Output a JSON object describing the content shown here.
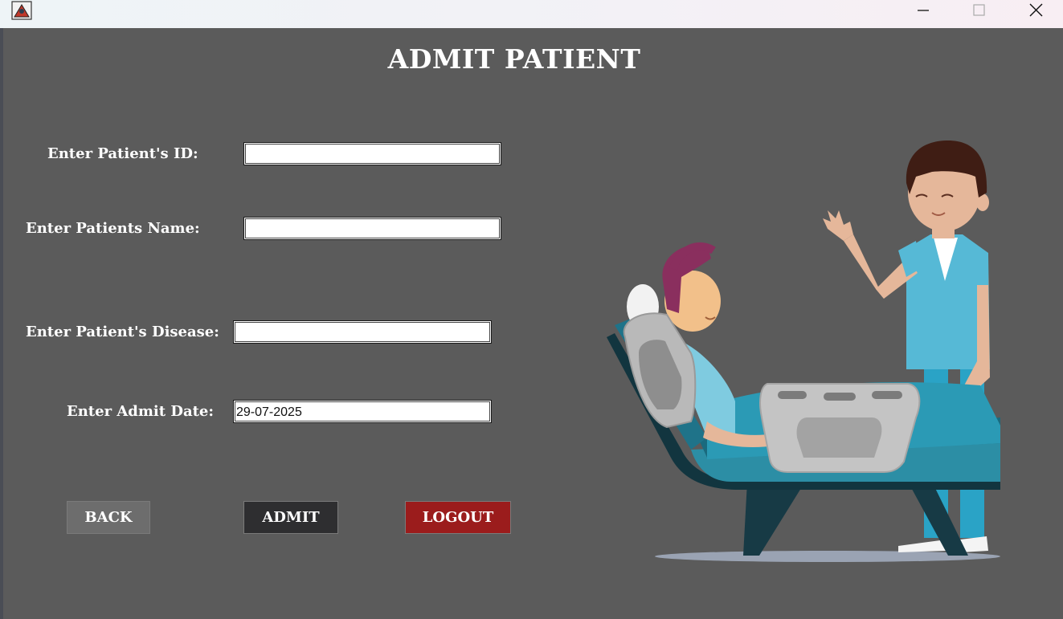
{
  "window": {
    "icons": {
      "app": "app-icon",
      "minimize": "minimize-icon",
      "maximize": "maximize-icon",
      "close": "close-icon"
    }
  },
  "page": {
    "title": "ADMIT PATIENT"
  },
  "form": {
    "patient_id": {
      "label": "Enter Patient's ID:",
      "value": ""
    },
    "patient_name": {
      "label": "Enter Patients Name:",
      "value": ""
    },
    "disease": {
      "label": "Enter Patient's Disease:",
      "value": ""
    },
    "admit_date": {
      "label": "Enter Admit Date:",
      "value": "29-07-2025"
    }
  },
  "buttons": {
    "back": "BACK",
    "admit": "ADMIT",
    "logout": "LOGOUT"
  },
  "colors": {
    "background": "#5b5b5b",
    "back_button": "#6d6d6d",
    "admit_button": "#2e2e30",
    "logout_button": "#9b1c1c"
  }
}
